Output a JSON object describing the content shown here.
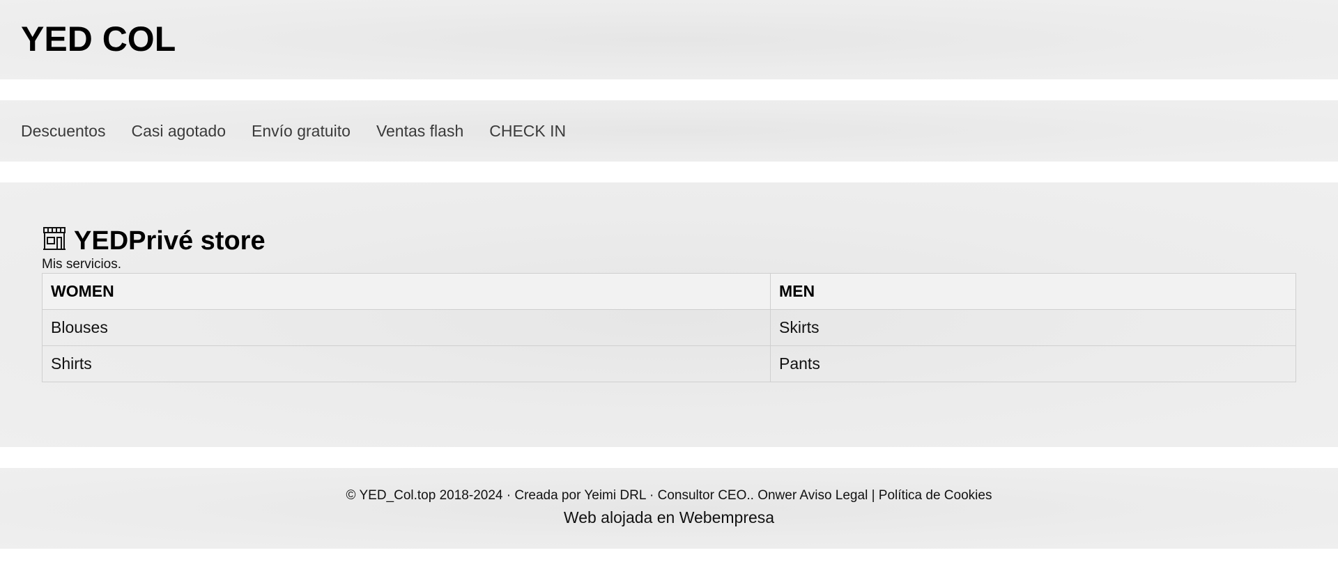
{
  "header": {
    "site_title": "YED COL"
  },
  "nav": {
    "items": [
      {
        "label": "Descuentos"
      },
      {
        "label": "Casi agotado"
      },
      {
        "label": "Envío gratuito"
      },
      {
        "label": "Ventas flash"
      },
      {
        "label": "CHECK IN"
      }
    ]
  },
  "main": {
    "heading_icon": "store-icon",
    "heading": "YEDPrivé store",
    "subtitle": "Mis servicios.",
    "table": {
      "headers": [
        "WOMEN",
        "MEN"
      ],
      "rows": [
        [
          "Blouses",
          "Skirts"
        ],
        [
          "Shirts",
          "Pants"
        ]
      ]
    }
  },
  "footer": {
    "copyright": "© YED_Col.top 2018-2024 · Creada por ",
    "author_link": "Yeimi DRL",
    "sep1": " · ",
    "ceo_link": "Consultor CEO.. Onwer",
    "sep2": " ",
    "legal_link": "Aviso Legal",
    "sep3": " | ",
    "cookies_link": "Política de Cookies",
    "hosted_prefix": "Web alojada en ",
    "hosted_link": "Webempresa"
  }
}
